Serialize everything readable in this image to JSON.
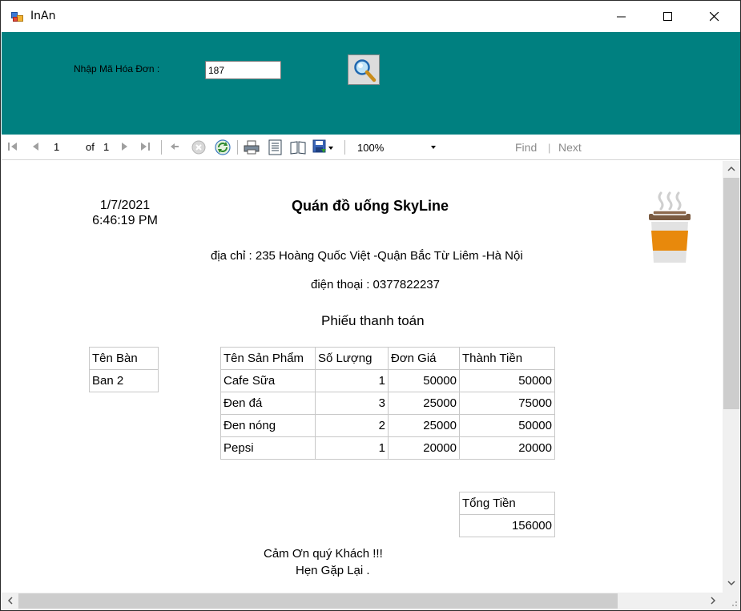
{
  "window": {
    "title": "InAn"
  },
  "form": {
    "invoice_label": "Nhập Mã Hóa Đơn :",
    "invoice_value": "187"
  },
  "toolbar": {
    "current_page": "1",
    "of_label": "of",
    "total_pages": "1",
    "zoom": "100%",
    "find_label": "Find",
    "find_separator": "|",
    "next_label": "Next"
  },
  "report": {
    "date": "1/7/2021",
    "time": "6:46:19 PM",
    "shop_name": "Quán đồ uống SkyLine",
    "address": "địa chỉ : 235 Hoàng Quốc Việt -Quận Bắc Từ Liêm -Hà Nội",
    "phone": "điện thoại : 0377822237",
    "heading": "Phiếu thanh toán",
    "table_header": "Tên Bàn",
    "table_value": "Ban 2",
    "items_headers": [
      "Tên Sản Phẩm",
      "Số Lượng",
      "Đơn Giá",
      "Thành Tiền"
    ],
    "items": [
      [
        "Cafe Sữa",
        "1",
        "50000",
        "50000"
      ],
      [
        "Đen đá",
        "3",
        "25000",
        "75000"
      ],
      [
        "Đen nóng",
        "2",
        "25000",
        "50000"
      ],
      [
        "Pepsi",
        "1",
        "20000",
        "20000"
      ]
    ],
    "total_header": "Tổng Tiền",
    "total_value": "156000",
    "thanks": "Cảm Ơn quý Khách !!!",
    "goodbye": "Hẹn Gặp Lại ."
  },
  "colors": {
    "panel": "#008080",
    "toolbar_background": "#ffffff",
    "cup_body": "#e8890c"
  },
  "icons": [
    "app-icon",
    "minimize-icon",
    "maximize-icon",
    "close-icon",
    "search-icon",
    "first-page-icon",
    "previous-page-icon",
    "next-page-icon",
    "last-page-icon",
    "back-icon",
    "stop-icon",
    "refresh-icon",
    "print-icon",
    "print-layout-icon",
    "page-setup-icon",
    "export-icon",
    "coffee-cup-icon"
  ]
}
